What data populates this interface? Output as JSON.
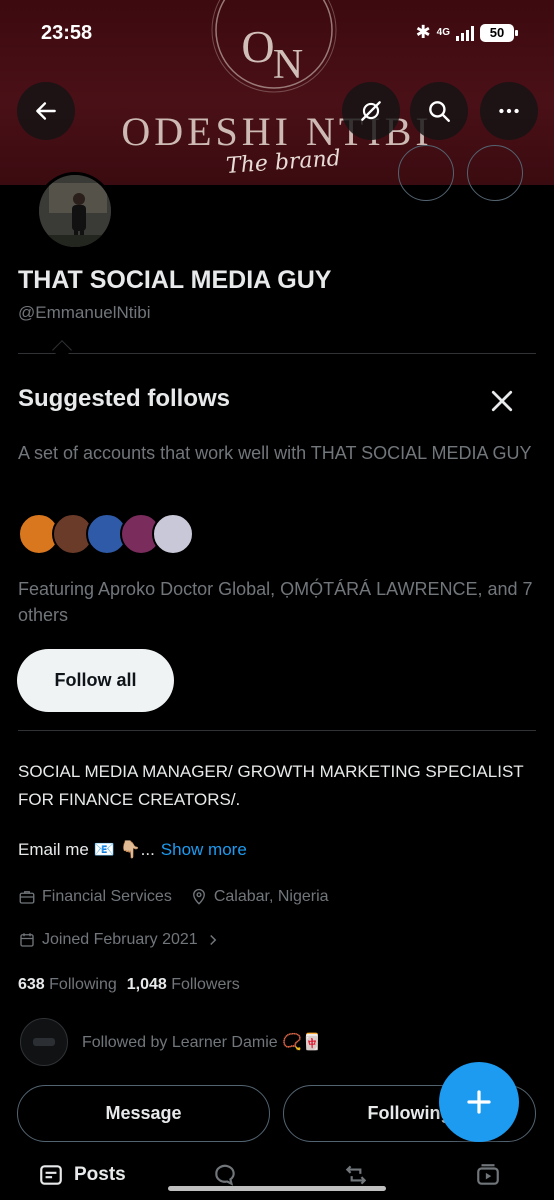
{
  "status_bar": {
    "time": "23:58",
    "network": "4G",
    "battery": "50"
  },
  "banner": {
    "monogram_left": "O",
    "monogram_right": "N",
    "brand_name": "ODESHI NTIBI",
    "brand_tagline": "The brand"
  },
  "profile": {
    "display_name": "THAT SOCIAL MEDIA GUY",
    "handle": "@EmmanuelNtibi",
    "bio": "SOCIAL MEDIA MANAGER/ GROWTH MARKETING SPECIALIST FOR FINANCE CREATORS/.",
    "email_prefix": "Email me 📧 👇🏼...",
    "show_more": "Show more",
    "category": "Financial Services",
    "location": "Calabar, Nigeria",
    "joined": "Joined February 2021",
    "following_count": "638",
    "following_label": "Following",
    "followers_count": "1,048",
    "followers_label": "Followers",
    "followed_by": "Followed by Learner Damie 📿🀄"
  },
  "suggested": {
    "title": "Suggested follows",
    "description": "A set of accounts that work well with THAT SOCIAL MEDIA GUY",
    "featuring": "Featuring Aproko Doctor Global, ỌMỌ́TÁRÁ LAWRENCE, and 7 others",
    "follow_all": "Follow all",
    "face_colors": [
      "#d9771f",
      "#6b3b2a",
      "#2f5aa8",
      "#7a2c5c",
      "#c8c8d8"
    ]
  },
  "actions": {
    "message": "Message",
    "following": "Following"
  },
  "tabs": {
    "posts": "Posts"
  },
  "colors": {
    "accent": "#1d9bf0",
    "banner": "#4a1017",
    "muted": "#71767b"
  }
}
